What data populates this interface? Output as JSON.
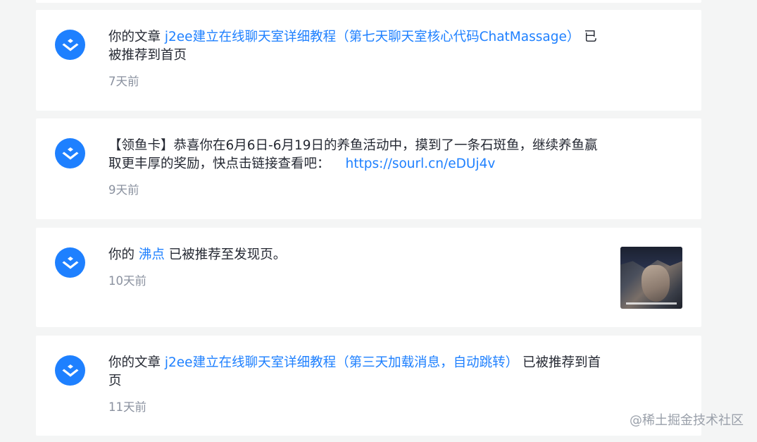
{
  "notifications": [
    {
      "prefix": "你的文章 ",
      "link": "j2ee建立在线聊天室详细教程（第七天聊天室核心代码ChatMassage）",
      "suffix": " 已被推荐到首页",
      "time": "7天前"
    },
    {
      "text": "【领鱼卡】恭喜你在6月6日-6月19日的养鱼活动中，摸到了一条石斑鱼，继续养鱼赢取更丰厚的奖励，快点击链接查看吧：",
      "link": "https://sourl.cn/eDUj4v",
      "time": "9天前"
    },
    {
      "prefix": "你的 ",
      "link": "沸点",
      "suffix": " 已被推荐至发现页。",
      "time": "10天前"
    },
    {
      "prefix": "你的文章 ",
      "link": "j2ee建立在线聊天室详细教程（第三天加载消息，自动跳转）",
      "suffix": " 已被推荐到首页",
      "time": "11天前"
    }
  ],
  "watermark": "@稀土掘金技术社区",
  "colors": {
    "accent": "#1e80ff",
    "text": "#252933",
    "muted": "#8a919f",
    "background": "#f4f5f5"
  },
  "icons": {
    "avatar": "juejin-logo-icon"
  }
}
